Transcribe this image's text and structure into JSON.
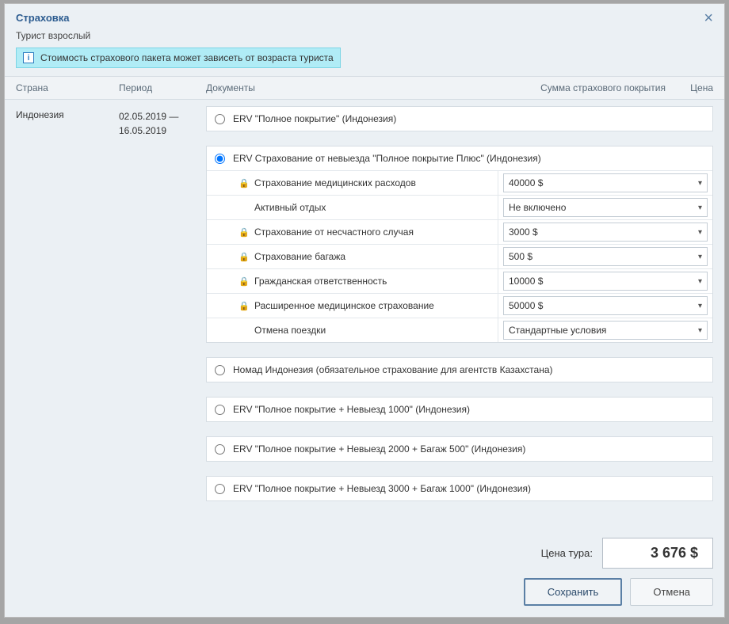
{
  "modal": {
    "title": "Страховка",
    "subtitle": "Турист взрослый",
    "info_text": "Стоимость страхового пакета может зависеть от возраста туриста"
  },
  "columns": {
    "country": "Страна",
    "period": "Период",
    "documents": "Документы",
    "coverage": "Сумма страхового покрытия",
    "price": "Цена"
  },
  "row": {
    "country": "Индонезия",
    "period_from": "02.05.2019 —",
    "period_to": "16.05.2019"
  },
  "packages": [
    {
      "label": "ERV \"Полное покрытие\" (Индонезия)",
      "selected": false
    },
    {
      "label": "ERV Страхование от невыезда \"Полное покрытие Плюс\" (Индонезия)",
      "selected": true
    },
    {
      "label": "Номад Индонезия (обязательное страхование для агентств Казахстана)",
      "selected": false
    },
    {
      "label": "ERV \"Полное покрытие + Невыезд 1000\" (Индонезия)",
      "selected": false
    },
    {
      "label": "ERV \"Полное покрытие + Невыезд 2000 + Багаж 500\" (Индонезия)",
      "selected": false
    },
    {
      "label": "ERV \"Полное покрытие + Невыезд 3000 + Багаж 1000\" (Индонезия)",
      "selected": false
    }
  ],
  "options": [
    {
      "locked": true,
      "label": "Страхование медицинских расходов",
      "value": "40000 $"
    },
    {
      "locked": false,
      "label": "Активный отдых",
      "value": "Не включено"
    },
    {
      "locked": true,
      "label": "Страхование от несчастного случая",
      "value": "3000 $"
    },
    {
      "locked": true,
      "label": "Страхование багажа",
      "value": "500 $"
    },
    {
      "locked": true,
      "label": "Гражданская ответственность",
      "value": "10000 $"
    },
    {
      "locked": true,
      "label": "Расширенное медицинское страхование",
      "value": "50000 $"
    },
    {
      "locked": false,
      "label": "Отмена поездки",
      "value": "Стандартные условия"
    }
  ],
  "footer": {
    "price_label": "Цена тура:",
    "price_value": "3 676 $",
    "save": "Сохранить",
    "cancel": "Отмена"
  }
}
